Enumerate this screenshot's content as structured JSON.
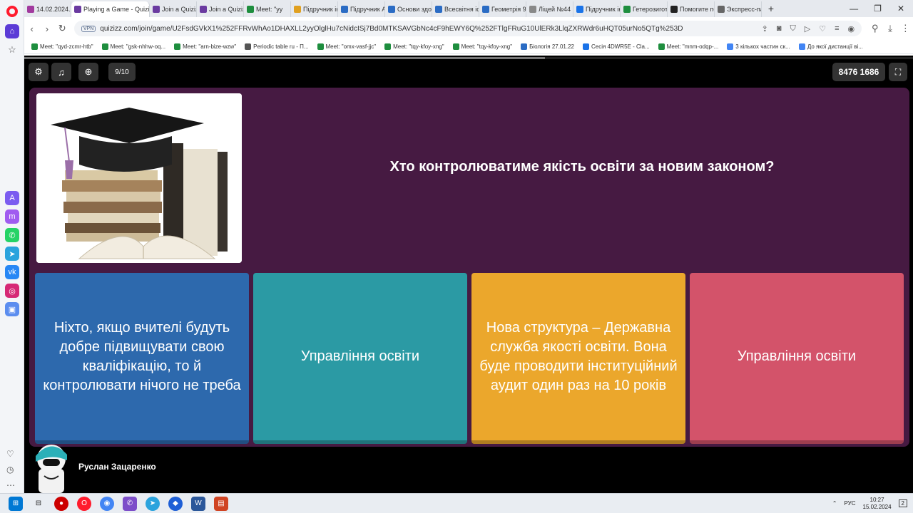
{
  "browser": {
    "tabs": [
      {
        "label": "14.02.2024.Ур",
        "color": "#a13a9e"
      },
      {
        "label": "Playing a Game - Quizizz",
        "color": "#6a3aa0",
        "active": true
      },
      {
        "label": "Join a Quizizz",
        "color": "#6a3aa0"
      },
      {
        "label": "Join a Quizizz",
        "color": "#6a3aa0"
      },
      {
        "label": "Meet: \"yy",
        "color": "#1e8e3e"
      },
      {
        "label": "Підручник ін",
        "color": "#e0a020"
      },
      {
        "label": "Підручник А",
        "color": "#2b6cc4"
      },
      {
        "label": "Основи здор",
        "color": "#2b6cc4"
      },
      {
        "label": "Всесвітня істо",
        "color": "#2b6cc4"
      },
      {
        "label": "Геометрія 9 у",
        "color": "#2b6cc4"
      },
      {
        "label": "Ліцей №44 м",
        "color": "#888888"
      },
      {
        "label": "Підручник ін",
        "color": "#1a73e8"
      },
      {
        "label": "Гетерозиготн",
        "color": "#1e8e3e"
      },
      {
        "label": "Помогите по",
        "color": "#222222"
      },
      {
        "label": "Экспресс-пан",
        "color": "#666666"
      }
    ],
    "url": "quizizz.com/join/game/U2FsdGVkX1%252FFRvWhAo1DHAXLL2yyOlglHu7cNidcISj7Bd0MTKSAVGbNc4cF9hEWY6Q%252FTlgFRuG10UlERk3LlqZXRWdr6uHQT05urNo5QTg%253D",
    "vpn_label": "VPN",
    "bookmarks": [
      {
        "label": "Meet: \"qyd-zcmr-htb\"",
        "color": "#1e8e3e"
      },
      {
        "label": "Meet: \"gsk-nhhw-oq...",
        "color": "#1e8e3e"
      },
      {
        "label": "Meet: \"arn-bize-wzw\"",
        "color": "#1e8e3e"
      },
      {
        "label": "Periodic table ru - П...",
        "color": "#555555"
      },
      {
        "label": "Meet: \"omx-vasf-jjc\"",
        "color": "#1e8e3e"
      },
      {
        "label": "Meet: \"tqy-kfoy-xng\"",
        "color": "#1e8e3e"
      },
      {
        "label": "Meet: \"tqy-kfoy-xng\"",
        "color": "#1e8e3e"
      },
      {
        "label": "Біологія 27.01.22",
        "color": "#2b6cc4"
      },
      {
        "label": "Сесія 4DWR5E - Cla...",
        "color": "#1a73e8"
      },
      {
        "label": "Meet: \"mnm-odqp-...",
        "color": "#1e8e3e"
      },
      {
        "label": "3 кількох частин ск...",
        "color": "#4285f4"
      },
      {
        "label": "До якої дистанції ві...",
        "color": "#4285f4"
      }
    ]
  },
  "game": {
    "question_counter": "9/10",
    "join_code": "8476 1686",
    "question": "Хто контролюватиме якість освіти за новим законом?",
    "options": [
      {
        "text": "Ніхто, якщо вчителі будуть добре підвищувати свою кваліфікацію, то й контролювати нічого не треба",
        "color": "#2d69ad"
      },
      {
        "text": "Управління освіти",
        "color": "#2b9aa4"
      },
      {
        "text": "Нова структура – Державна служба якості освіти. Вона буде проводити інституційний аудит один раз на 10 років",
        "color": "#eba72c"
      },
      {
        "text": "Управління освіти",
        "color": "#d3536a"
      }
    ],
    "player_name": "Руслан Зацаренко"
  },
  "taskbar": {
    "lang": "РУС",
    "time": "10:27",
    "date": "15.02.2024",
    "notifications": "2"
  }
}
